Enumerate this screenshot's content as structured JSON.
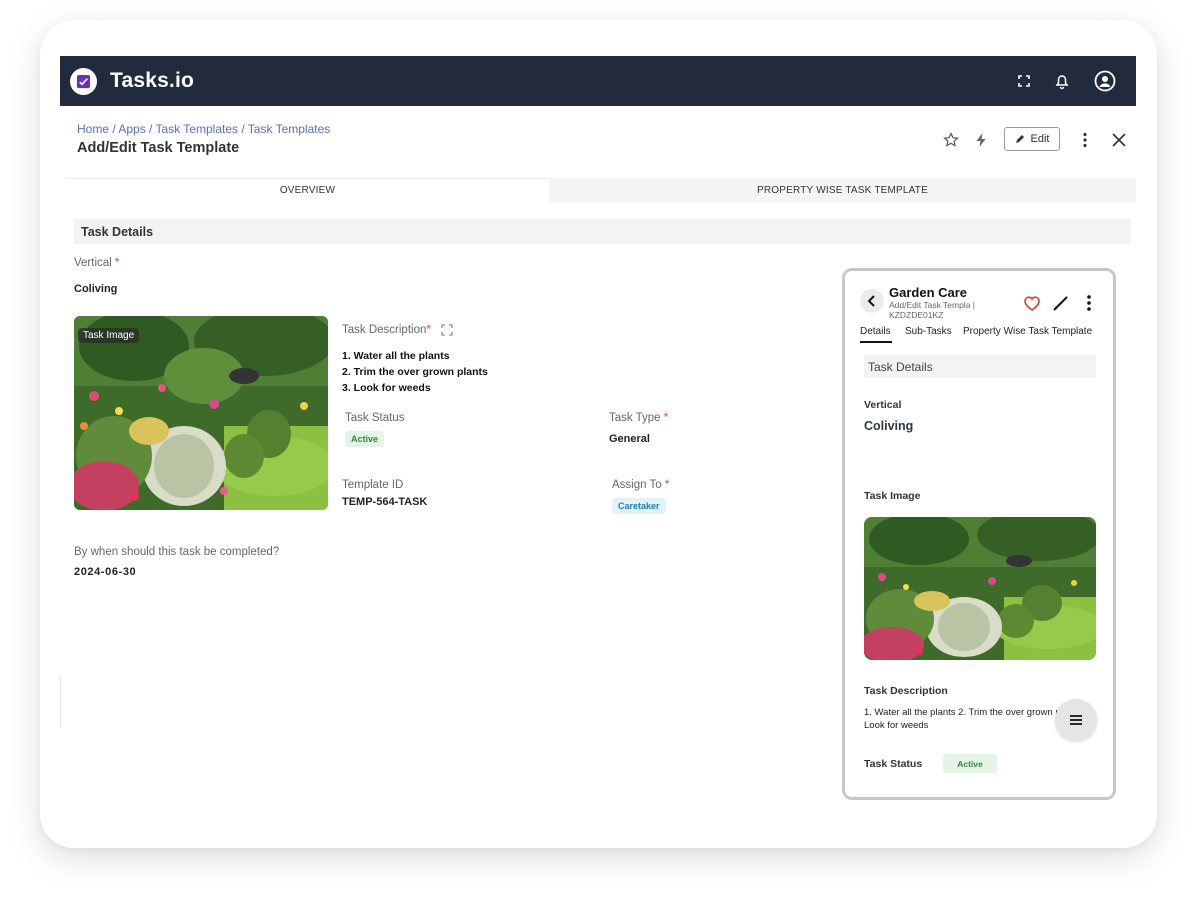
{
  "app": {
    "brand": "Tasks.io"
  },
  "breadcrumb": [
    "Home",
    "Apps",
    "Task Templates",
    "Task Templates"
  ],
  "page_title": "Add/Edit Task Template",
  "header_actions": {
    "edit_label": "Edit"
  },
  "tabs": [
    {
      "label": "OVERVIEW",
      "active": true
    },
    {
      "label": "PROPERTY WISE TASK TEMPLATE",
      "active": false
    }
  ],
  "form": {
    "section_title": "Task Details",
    "vertical_label": "Vertical",
    "vertical_value": "Coliving",
    "image_badge": "Task Image",
    "description_label": "Task Description",
    "description_items": [
      "1. Water all the plants",
      "2. Trim the over grown plants",
      "3. Look for weeds"
    ],
    "status_label": "Task Status",
    "status_value": "Active",
    "type_label": "Task Type",
    "type_value": "General",
    "template_id_label": "Template ID",
    "template_id_value": "TEMP-564-TASK",
    "assign_label": "Assign To",
    "assign_value": "Caretaker",
    "due_label": "By when should this task be completed?",
    "due_value": "2024-06-30",
    "required_mark": "*"
  },
  "mobile": {
    "title": "Garden Care",
    "subtitle": "Add/Edit Task Templa | KZDZDE01KZ",
    "tabs": [
      "Details",
      "Sub-Tasks",
      "Property Wise Task Template"
    ],
    "section_title": "Task Details",
    "vertical_label": "Vertical",
    "vertical_value": "Coliving",
    "image_label": "Task Image",
    "description_label": "Task Description",
    "description_text": "1. Water all the plants 2. Trim the over grown plants 3. Look for weeds",
    "status_label": "Task Status",
    "status_value": "Active"
  },
  "colors": {
    "topbar": "#222a3e",
    "accent": "#5c6bc0",
    "required": "#e53935",
    "active_chip": "#2e8b3a",
    "assign_chip": "#1a7fc1"
  },
  "icons": [
    "logo-icon",
    "fullscreen-icon",
    "bell-icon",
    "user-icon",
    "star-icon",
    "flash-icon",
    "pencil-icon",
    "more-vertical-icon",
    "close-icon",
    "expand-icon",
    "back-icon",
    "heart-icon",
    "menu-icon"
  ]
}
